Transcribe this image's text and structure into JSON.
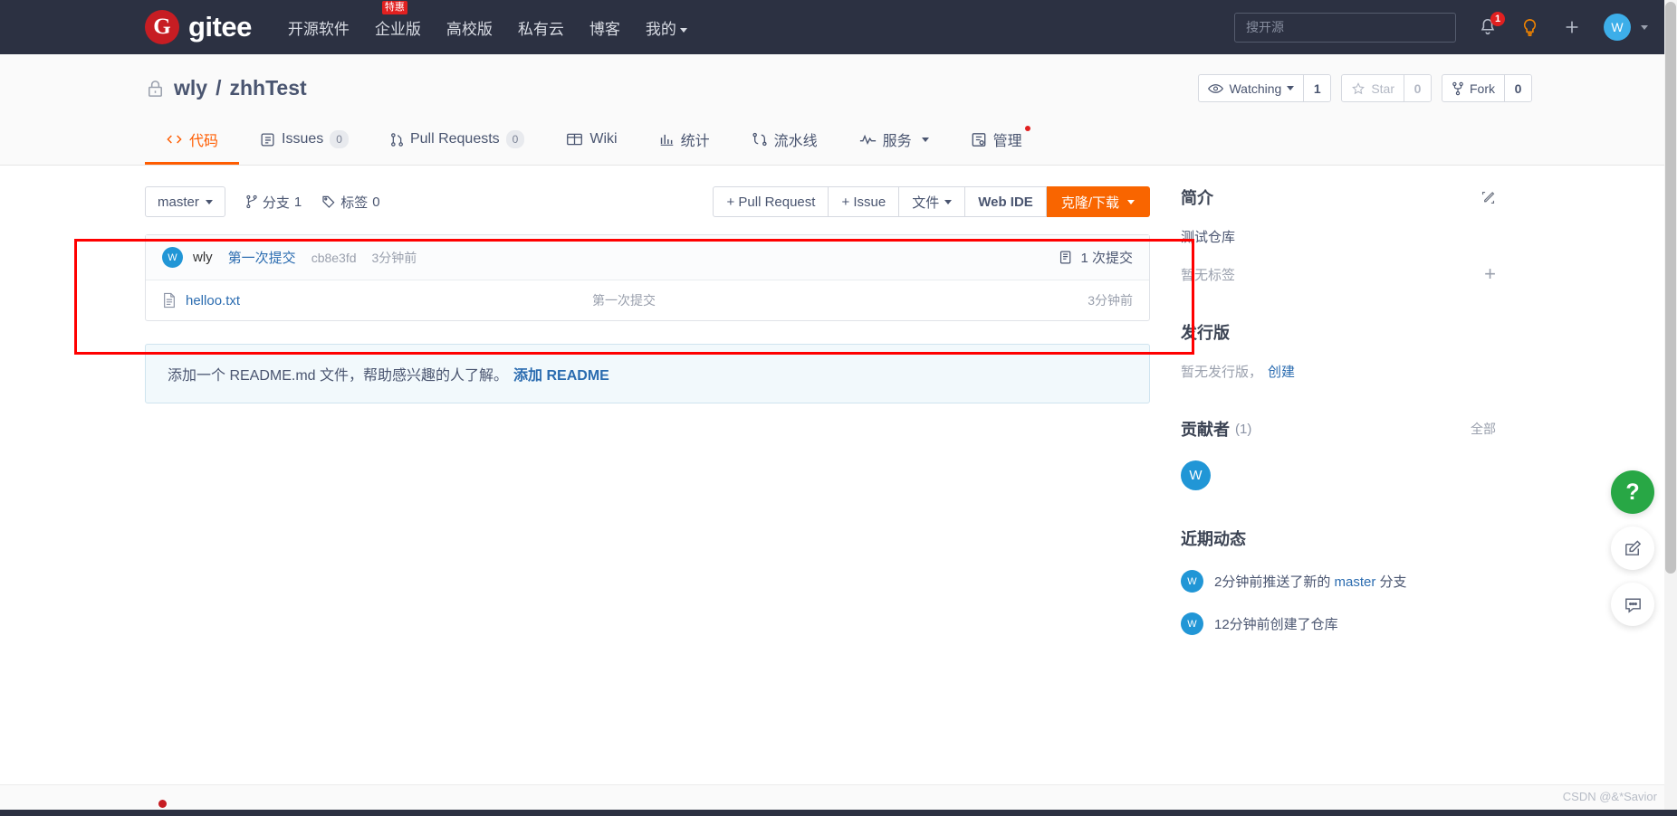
{
  "topnav": {
    "logo_letter": "G",
    "logo_text": "gitee",
    "links": [
      {
        "label": "开源软件",
        "badge": ""
      },
      {
        "label": "企业版",
        "badge": "特惠"
      },
      {
        "label": "高校版",
        "badge": ""
      },
      {
        "label": "私有云",
        "badge": ""
      },
      {
        "label": "博客",
        "badge": ""
      },
      {
        "label": "我的",
        "badge": ""
      }
    ],
    "search_placeholder": "搜开源",
    "notification_count": "1",
    "avatar_letter": "W",
    "icons": [
      "bell-icon",
      "lightbulb-icon",
      "plus-icon",
      "avatar"
    ],
    "accent_color": "#c71d23",
    "bg_color": "#2c3142"
  },
  "repo": {
    "owner": "wly",
    "separator": "/",
    "name": "zhhTest",
    "visibility_icon": "lock-icon",
    "watch": {
      "label": "Watching",
      "count": "1"
    },
    "star": {
      "label": "Star",
      "count": "0"
    },
    "fork": {
      "label": "Fork",
      "count": "0"
    }
  },
  "tabs": [
    {
      "label": "代码",
      "icon": "code-icon",
      "count": "",
      "active": true,
      "dot": false
    },
    {
      "label": "Issues",
      "icon": "issue-icon",
      "count": "0",
      "active": false,
      "dot": false
    },
    {
      "label": "Pull Requests",
      "icon": "pr-icon",
      "count": "0",
      "active": false,
      "dot": false
    },
    {
      "label": "Wiki",
      "icon": "wiki-icon",
      "count": "",
      "active": false,
      "dot": false
    },
    {
      "label": "统计",
      "icon": "chart-icon",
      "count": "",
      "active": false,
      "dot": false
    },
    {
      "label": "流水线",
      "icon": "pipeline-icon",
      "count": "",
      "active": false,
      "dot": false
    },
    {
      "label": "服务",
      "icon": "service-icon",
      "count": "",
      "active": false,
      "dot": false,
      "caret": true
    },
    {
      "label": "管理",
      "icon": "manage-icon",
      "count": "",
      "active": false,
      "dot": true
    }
  ],
  "toolbar": {
    "branch": "master",
    "branches_label": "分支",
    "branches_count": "1",
    "tags_label": "标签",
    "tags_count": "0",
    "pull_request_btn": "+ Pull Request",
    "issue_btn": "+ Issue",
    "file_btn": "文件",
    "webide_btn": "Web IDE",
    "clone_btn": "克隆/下载"
  },
  "commit": {
    "avatar_letter": "W",
    "author": "wly",
    "message": "第一次提交",
    "sha": "cb8e3fd",
    "time": "3分钟前",
    "count_label": "1 次提交"
  },
  "files": [
    {
      "icon": "file-icon",
      "name": "helloo.txt",
      "commit": "第一次提交",
      "time": "3分钟前"
    }
  ],
  "readme_tip": {
    "text": "添加一个 README.md 文件，帮助感兴趣的人了解。",
    "link": "添加 README"
  },
  "sidebar": {
    "intro": {
      "title": "简介",
      "edit_icon": "edit-icon",
      "description": "测试仓库",
      "tags_empty": "暂无标签",
      "add_tag_icon": "plus-icon"
    },
    "release": {
      "title": "发行版",
      "empty_text": "暂无发行版，",
      "create_link": "创建"
    },
    "contributors": {
      "title": "贡献者",
      "count": "(1)",
      "all_link": "全部",
      "avatars": [
        {
          "letter": "W"
        }
      ]
    },
    "activity": {
      "title": "近期动态",
      "items": [
        {
          "avatar_letter": "W",
          "prefix": "2分钟前推送了新的 ",
          "highlight": "master",
          "suffix": " 分支"
        },
        {
          "avatar_letter": "W",
          "prefix": "12分钟前创建了仓库",
          "highlight": "",
          "suffix": ""
        }
      ]
    }
  },
  "floaters": [
    {
      "name": "help-button",
      "glyph": "?",
      "style": "green"
    },
    {
      "name": "feedback-button",
      "glyph": "",
      "style": "white"
    },
    {
      "name": "chat-button",
      "glyph": "",
      "style": "white"
    }
  ],
  "watermark": "CSDN @&*Savior",
  "annotation": {
    "highlight_color": "#ff0000"
  }
}
